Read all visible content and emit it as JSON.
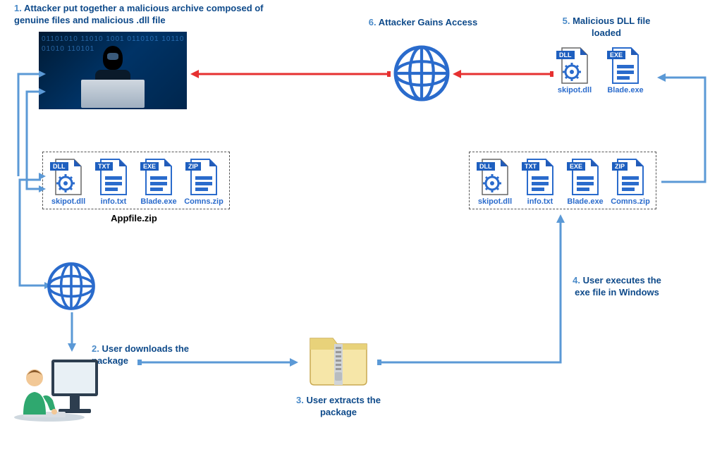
{
  "steps": {
    "s1": {
      "num": "1.",
      "text": "Attacker put together a malicious archive composed of genuine files and malicious .dll file"
    },
    "s2": {
      "num": "2.",
      "text": "User downloads the package"
    },
    "s3": {
      "num": "3.",
      "text": "User extracts the package"
    },
    "s4": {
      "num": "4.",
      "text": "User executes the exe file in Windows"
    },
    "s5": {
      "num": "5.",
      "text": "Malicious DLL file loaded"
    },
    "s6": {
      "num": "6.",
      "text": "Attacker Gains Access"
    }
  },
  "files": {
    "dll": {
      "badge": "DLL",
      "name": "skipot.dll"
    },
    "txt": {
      "badge": "TXT",
      "name": "info.txt"
    },
    "exe": {
      "badge": "EXE",
      "name": "Blade.exe"
    },
    "zip": {
      "badge": "ZIP",
      "name": "Comns.zip"
    }
  },
  "archive_label": "Appfile.zip",
  "colors": {
    "blue": "#2a6bcc",
    "arrow_blue": "#5b99d6",
    "arrow_red": "#e63030",
    "navy_text": "#0e4a8a"
  }
}
